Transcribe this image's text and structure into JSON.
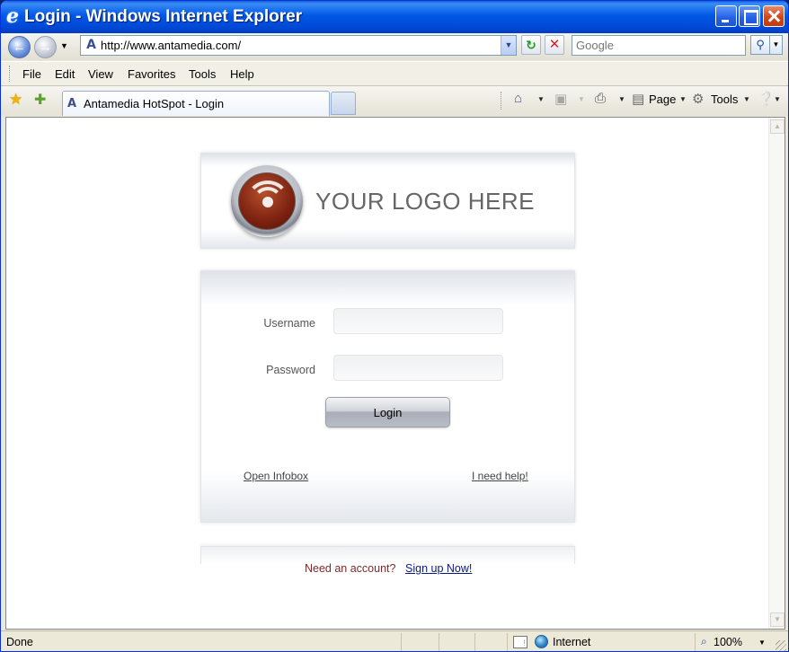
{
  "window": {
    "title": "Login - Windows Internet Explorer",
    "app_icon": "ie-logo-icon"
  },
  "navigation": {
    "address_url": "http://www.antamedia.com/",
    "search_placeholder": "Google"
  },
  "menu": {
    "items": [
      "File",
      "Edit",
      "View",
      "Favorites",
      "Tools",
      "Help"
    ]
  },
  "tabs": {
    "active_label": "Antamedia HotSpot - Login"
  },
  "commandbar": {
    "page_label": "Page",
    "tools_label": "Tools"
  },
  "page": {
    "logo_text": "YOUR LOGO HERE",
    "login": {
      "username_label": "Username",
      "password_label": "Password",
      "username_value": "",
      "password_value": "",
      "button_label": "Login",
      "open_infobox": "Open Infobox",
      "need_help": "I need help!"
    },
    "signup": {
      "prompt": "Need an account?",
      "link": "Sign up Now!"
    }
  },
  "statusbar": {
    "status": "Done",
    "zone": "Internet",
    "zoom": "100%"
  },
  "colors": {
    "titlebar": "#0058e6",
    "signup_prompt": "#7a2a2a",
    "signup_link": "#0b1a80",
    "logo_core": "#7d2210"
  }
}
